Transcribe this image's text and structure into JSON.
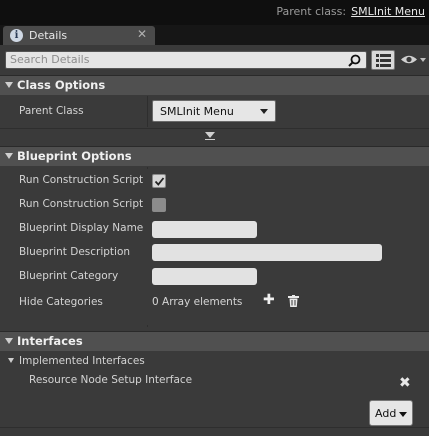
{
  "header": {
    "parent_class_label": "Parent class:",
    "parent_class_value": "SMLInit Menu"
  },
  "tab": {
    "label": "Details",
    "close": "✕"
  },
  "search": {
    "placeholder": "Search Details"
  },
  "class_options": {
    "title": "Class Options",
    "parent_class": {
      "label": "Parent Class",
      "value": "SMLInit Menu"
    }
  },
  "blueprint_options": {
    "title": "Blueprint Options",
    "run_construction_script_1": {
      "label": "Run Construction Script o",
      "checked": true
    },
    "run_construction_script_2": {
      "label": "Run Construction Script in",
      "checked": false
    },
    "display_name": {
      "label": "Blueprint Display Name",
      "value": ""
    },
    "description": {
      "label": "Blueprint Description",
      "value": ""
    },
    "category": {
      "label": "Blueprint Category",
      "value": ""
    },
    "hide_categories": {
      "label": "Hide Categories",
      "value": "0 Array elements"
    }
  },
  "interfaces": {
    "title": "Interfaces",
    "implemented_label": "Implemented Interfaces",
    "items": [
      "Resource Node Setup Interface"
    ],
    "add_label": "Add"
  }
}
